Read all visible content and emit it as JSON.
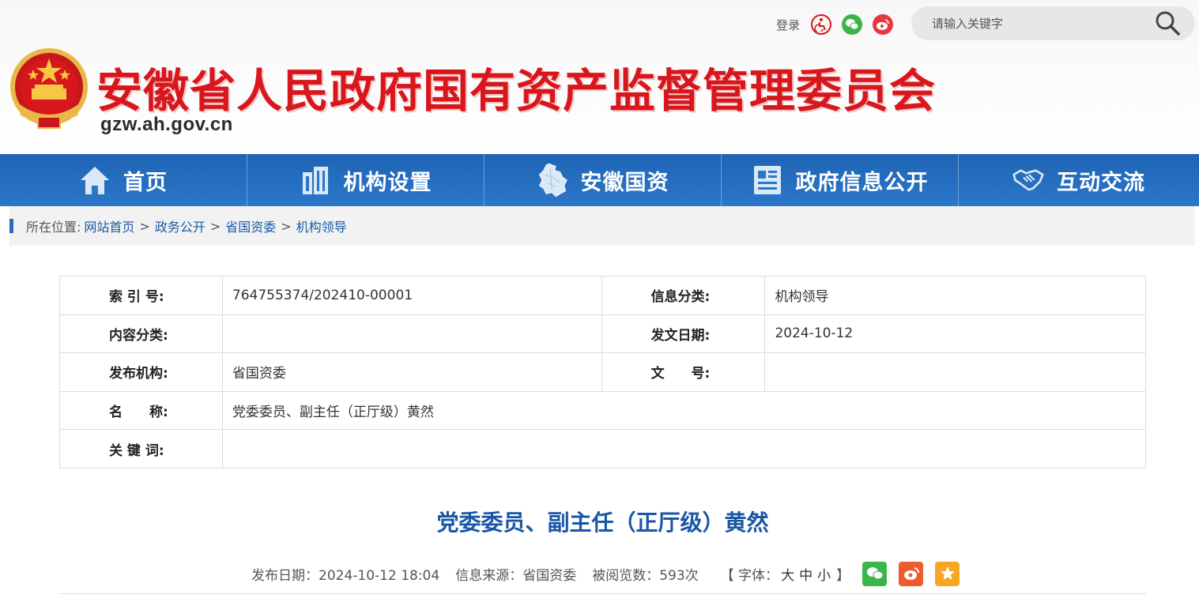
{
  "header": {
    "site_title": "安徽省人民政府国有资产监督管理委员会",
    "site_domain": "gzw.ah.gov.cn",
    "login": "登录",
    "search_placeholder": "请输入关键字",
    "accent_red": "#d8171d"
  },
  "nav": {
    "items": [
      {
        "label": "首页",
        "icon": "home-icon"
      },
      {
        "label": "机构设置",
        "icon": "building-icon"
      },
      {
        "label": "安徽国资",
        "icon": "province-map-icon"
      },
      {
        "label": "政府信息公开",
        "icon": "document-icon"
      },
      {
        "label": "互动交流",
        "icon": "handshake-icon"
      }
    ],
    "color": "#2266b8"
  },
  "breadcrumb": {
    "prefix": "所在位置:",
    "items": [
      "网站首页",
      "政务公开",
      "省国资委",
      "机构领导"
    ],
    "separator": ">"
  },
  "info": {
    "index_label": "索 引 号:",
    "index_value": "764755374/202410-00001",
    "category_label": "信息分类:",
    "category_value": "机构领导",
    "content_type_label": "内容分类:",
    "content_type_value": "",
    "date_label": "发文日期:",
    "date_value": "2024-10-12",
    "publisher_label": "发布机构:",
    "publisher_value": "省国资委",
    "doc_no_label": "文　　号:",
    "doc_no_value": "",
    "name_label": "名　　称:",
    "name_value": "党委委员、副主任（正厅级）黄然",
    "keywords_label": "关 键 词:",
    "keywords_value": ""
  },
  "article": {
    "title": "党委委员、副主任（正厅级）黄然",
    "publish_date": "发布日期：2024-10-12 18:04",
    "source": "信息来源：省国资委",
    "views": "被阅览数：593次",
    "font_label_open": "【 字体：",
    "font_large": "大",
    "font_medium": "中",
    "font_small": "小",
    "font_label_close": "】"
  }
}
